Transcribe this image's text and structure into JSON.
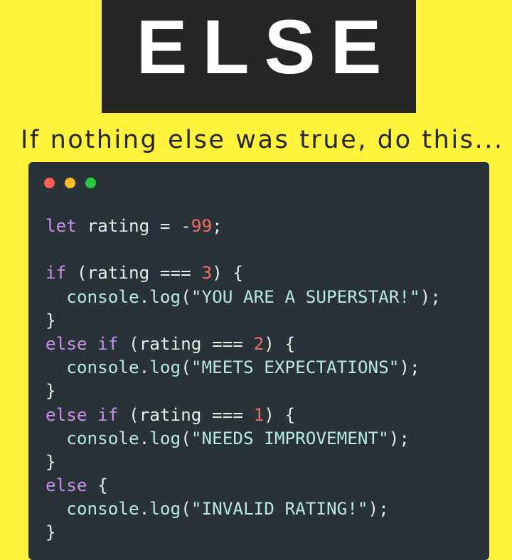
{
  "header": {
    "title": "ELSE",
    "subtitle": "If nothing else was true, do this..."
  },
  "code_window": {
    "dots": [
      {
        "name": "close",
        "color": "#FF5F56"
      },
      {
        "name": "minimize",
        "color": "#FFBD2E"
      },
      {
        "name": "maximize",
        "color": "#27C93F"
      }
    ],
    "colors": {
      "background": "#283237",
      "keyword": "#C792EA",
      "plain": "#E8EAEA",
      "number": "#F26D6A",
      "function": "#B8E8E0",
      "string": "#B8E8E0"
    },
    "lines": [
      [
        {
          "t": "let",
          "c": "keyword"
        },
        {
          "t": " rating = -",
          "c": "plain"
        },
        {
          "t": "99",
          "c": "number"
        },
        {
          "t": ";",
          "c": "plain"
        }
      ],
      [],
      [
        {
          "t": "if",
          "c": "keyword"
        },
        {
          "t": " (rating === ",
          "c": "plain"
        },
        {
          "t": "3",
          "c": "number"
        },
        {
          "t": ") {",
          "c": "plain"
        }
      ],
      [
        {
          "t": "  console",
          "c": "function"
        },
        {
          "t": ".",
          "c": "plain"
        },
        {
          "t": "log",
          "c": "function"
        },
        {
          "t": "(",
          "c": "plain"
        },
        {
          "t": "\"YOU ARE A SUPERSTAR!\"",
          "c": "string"
        },
        {
          "t": ");",
          "c": "plain"
        }
      ],
      [
        {
          "t": "}",
          "c": "plain"
        }
      ],
      [
        {
          "t": "else if",
          "c": "keyword"
        },
        {
          "t": " (rating === ",
          "c": "plain"
        },
        {
          "t": "2",
          "c": "number"
        },
        {
          "t": ") {",
          "c": "plain"
        }
      ],
      [
        {
          "t": "  console",
          "c": "function"
        },
        {
          "t": ".",
          "c": "plain"
        },
        {
          "t": "log",
          "c": "function"
        },
        {
          "t": "(",
          "c": "plain"
        },
        {
          "t": "\"MEETS EXPECTATIONS\"",
          "c": "string"
        },
        {
          "t": ");",
          "c": "plain"
        }
      ],
      [
        {
          "t": "}",
          "c": "plain"
        }
      ],
      [
        {
          "t": "else if",
          "c": "keyword"
        },
        {
          "t": " (rating === ",
          "c": "plain"
        },
        {
          "t": "1",
          "c": "number"
        },
        {
          "t": ") {",
          "c": "plain"
        }
      ],
      [
        {
          "t": "  console",
          "c": "function"
        },
        {
          "t": ".",
          "c": "plain"
        },
        {
          "t": "log",
          "c": "function"
        },
        {
          "t": "(",
          "c": "plain"
        },
        {
          "t": "\"NEEDS IMPROVEMENT\"",
          "c": "string"
        },
        {
          "t": ");",
          "c": "plain"
        }
      ],
      [
        {
          "t": "}",
          "c": "plain"
        }
      ],
      [
        {
          "t": "else",
          "c": "keyword"
        },
        {
          "t": " {",
          "c": "plain"
        }
      ],
      [
        {
          "t": "  console",
          "c": "function"
        },
        {
          "t": ".",
          "c": "plain"
        },
        {
          "t": "log",
          "c": "function"
        },
        {
          "t": "(",
          "c": "plain"
        },
        {
          "t": "\"INVALID RATING!\"",
          "c": "string"
        },
        {
          "t": ");",
          "c": "plain"
        }
      ],
      [
        {
          "t": "}",
          "c": "plain"
        }
      ]
    ]
  }
}
